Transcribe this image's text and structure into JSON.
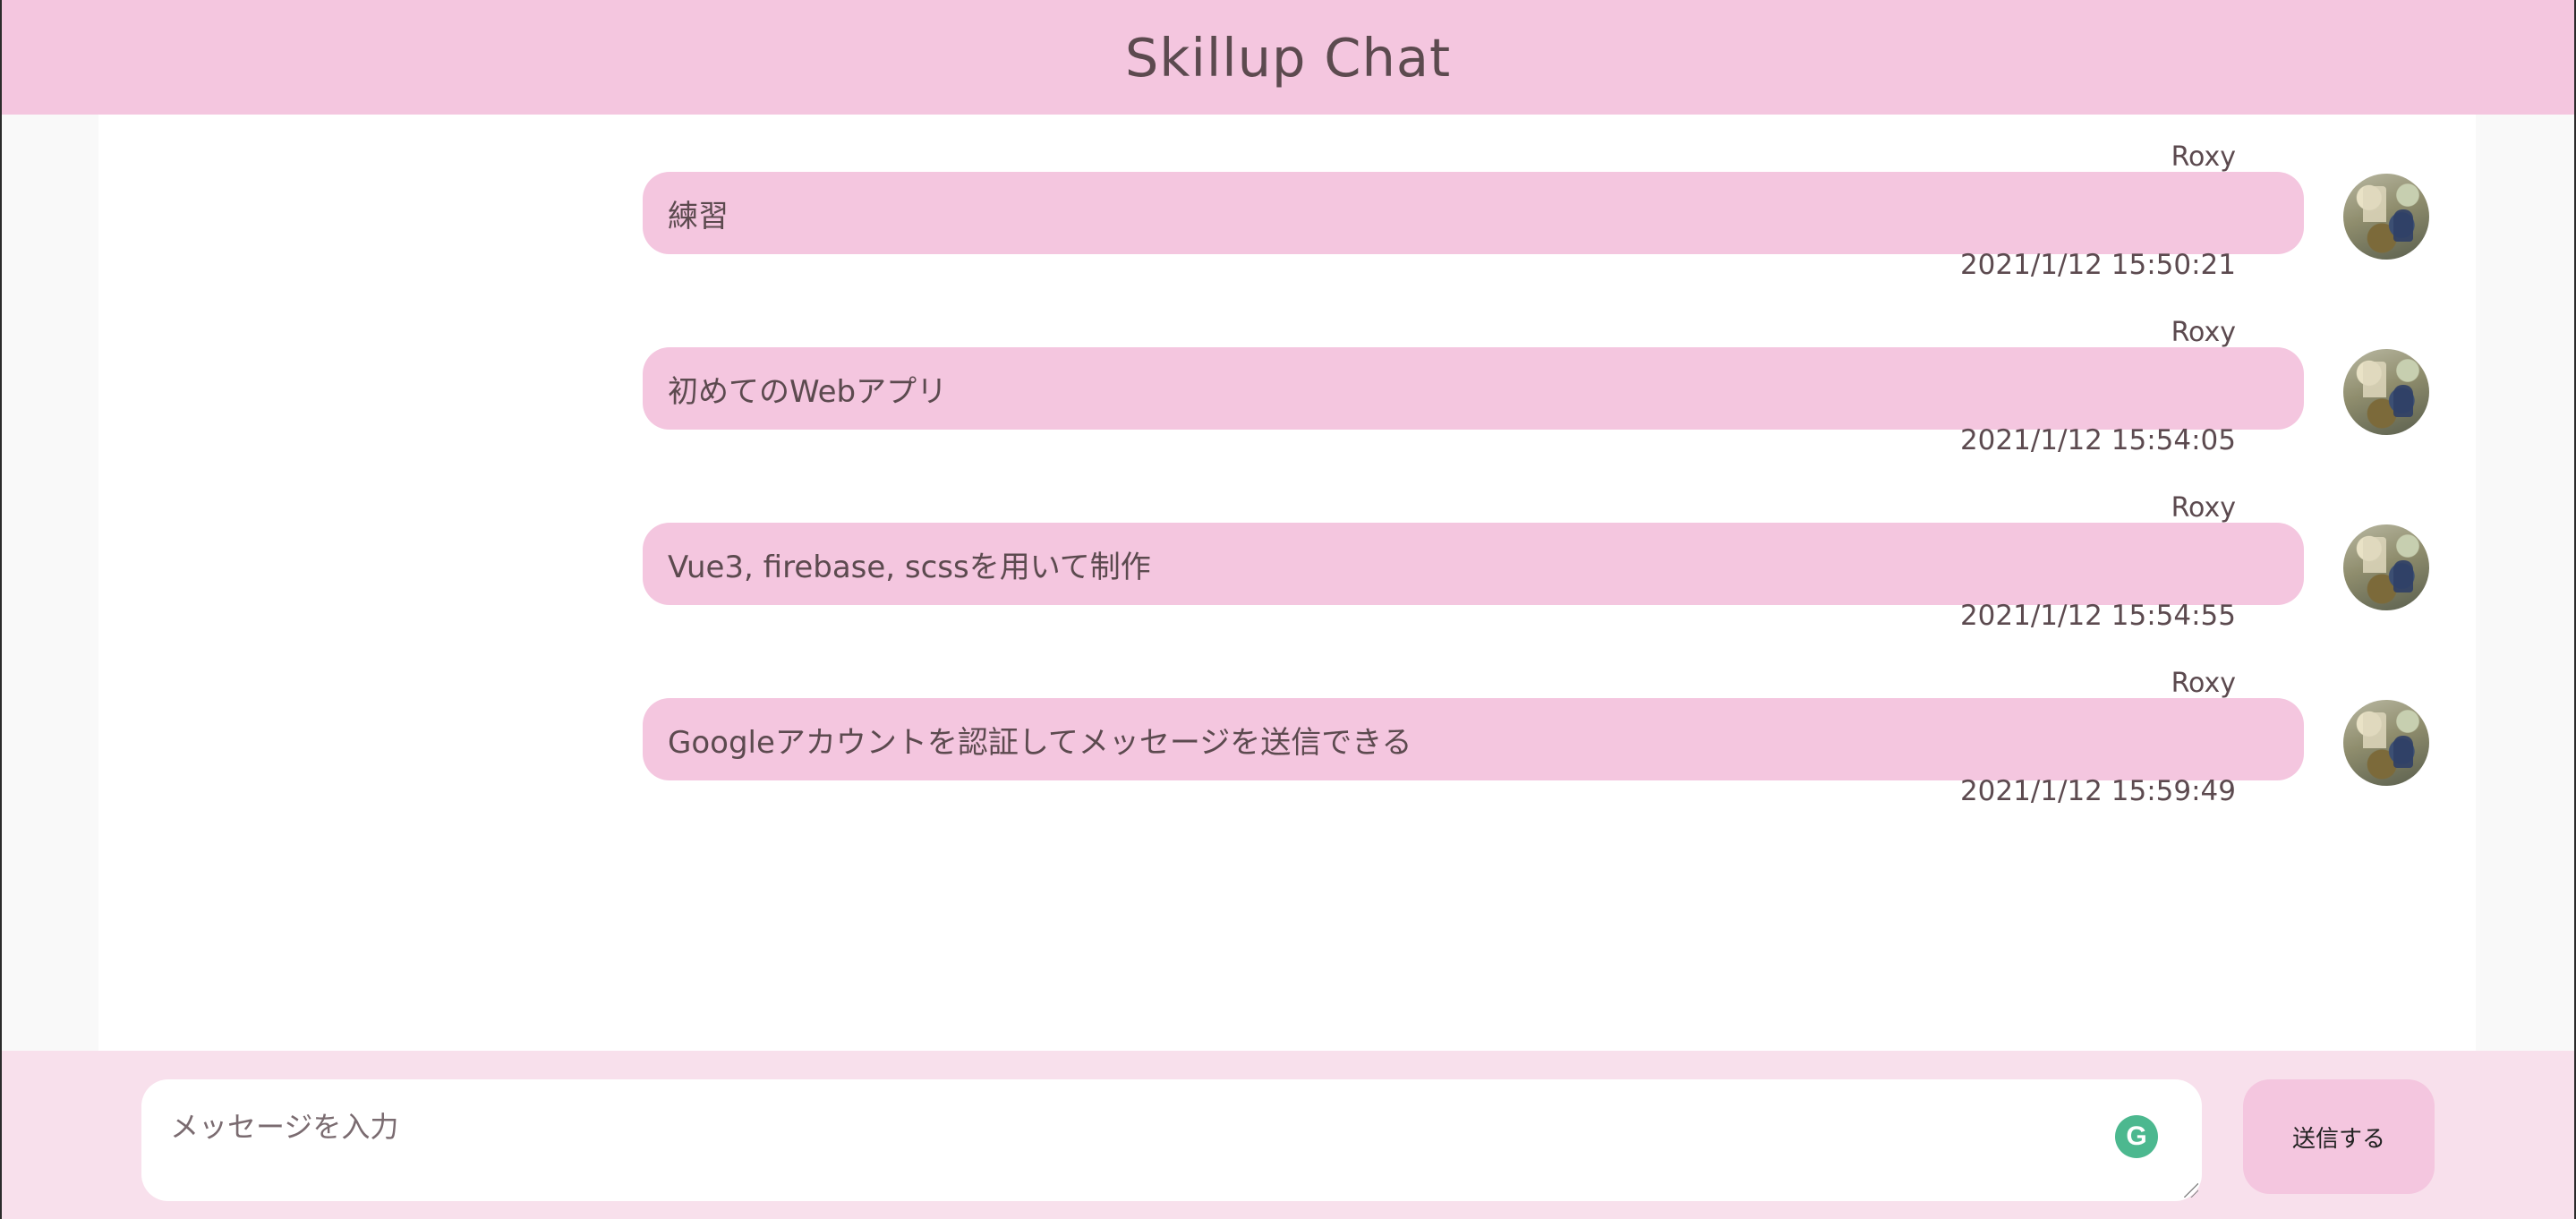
{
  "app": {
    "title": "Skillup Chat"
  },
  "colors": {
    "header_bg": "#f4c6df",
    "bubble_bg": "#f4c6df",
    "footer_bg": "#f8e0ec",
    "text": "#5c4a4f",
    "grammarly_green": "#4cb88f"
  },
  "messages": [
    {
      "name": "Roxy",
      "text": "練習",
      "time": "2021/1/12 15:50:21",
      "avatar_icon": "avatar-image"
    },
    {
      "name": "Roxy",
      "text": "初めてのWebアプリ",
      "time": "2021/1/12 15:54:05",
      "avatar_icon": "avatar-image"
    },
    {
      "name": "Roxy",
      "text": "Vue3, firebase, scssを用いて制作",
      "time": "2021/1/12 15:54:55",
      "avatar_icon": "avatar-image"
    },
    {
      "name": "Roxy",
      "text": "Googleアカウントを認証してメッセージを送信できる",
      "time": "2021/1/12 15:59:49",
      "avatar_icon": "avatar-image"
    }
  ],
  "composer": {
    "placeholder": "メッセージを入力",
    "value": "",
    "grammarly_glyph": "G",
    "send_label": "送信する"
  }
}
